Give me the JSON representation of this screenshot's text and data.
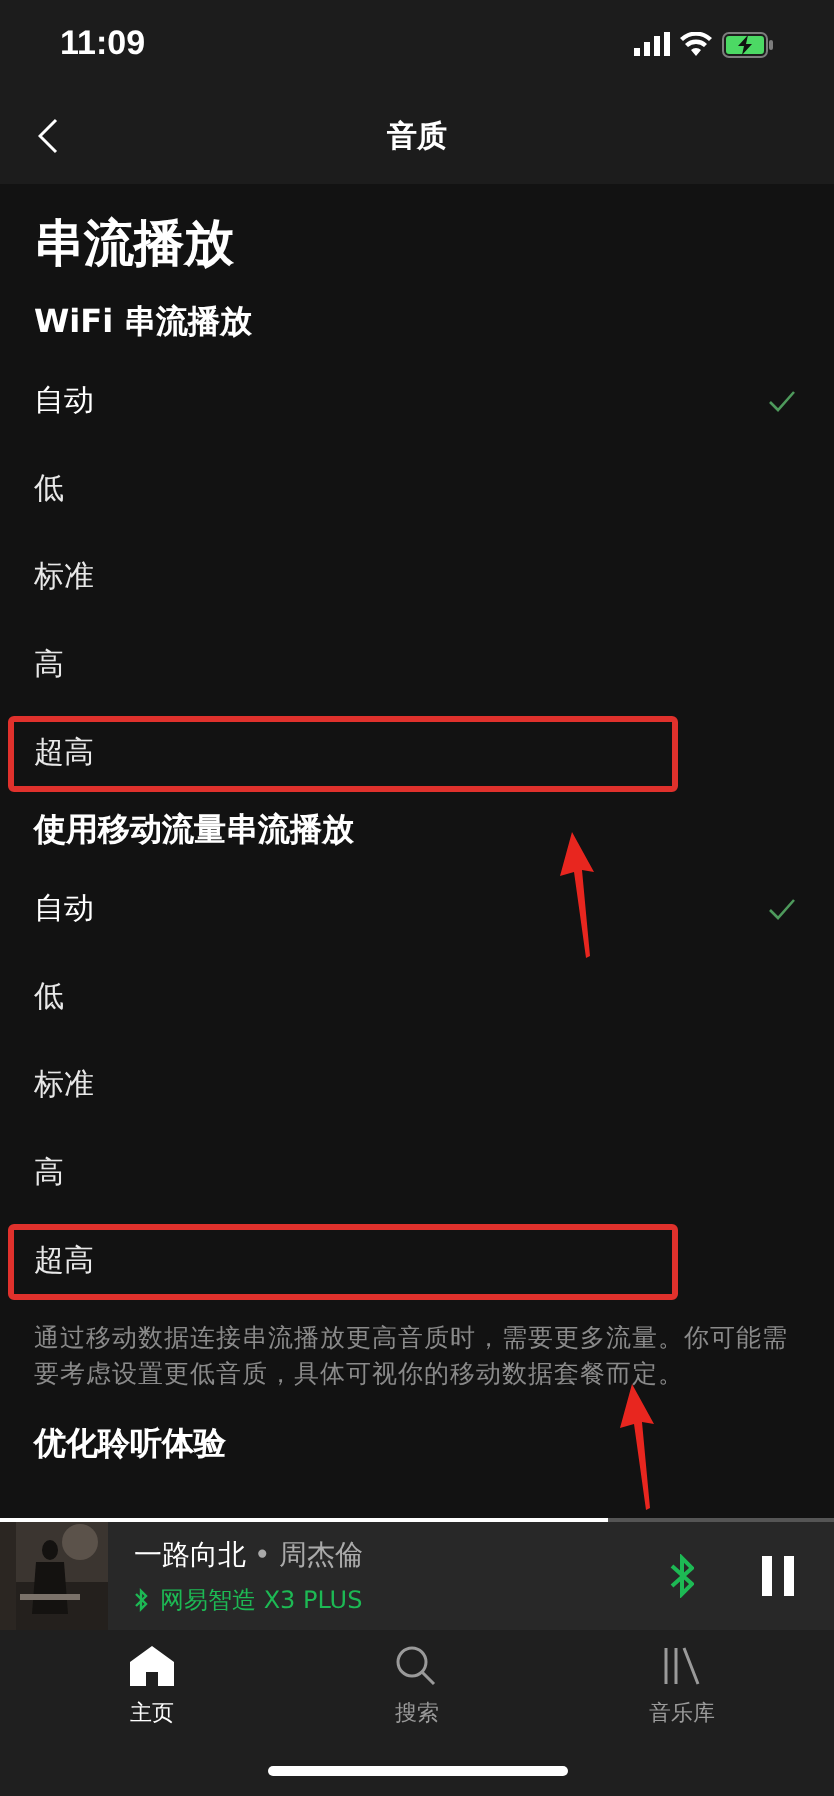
{
  "status_bar": {
    "time": "11:09"
  },
  "nav": {
    "title": "音质"
  },
  "page_title": "串流播放",
  "sections": [
    {
      "heading": "WiFi 串流播放",
      "options": [
        {
          "label": "自动",
          "selected": true,
          "highlighted": false
        },
        {
          "label": "低",
          "selected": false,
          "highlighted": false
        },
        {
          "label": "标准",
          "selected": false,
          "highlighted": false
        },
        {
          "label": "高",
          "selected": false,
          "highlighted": false
        },
        {
          "label": "超高",
          "selected": false,
          "highlighted": true
        }
      ]
    },
    {
      "heading": "使用移动流量串流播放",
      "options": [
        {
          "label": "自动",
          "selected": true,
          "highlighted": false
        },
        {
          "label": "低",
          "selected": false,
          "highlighted": false
        },
        {
          "label": "标准",
          "selected": false,
          "highlighted": false
        },
        {
          "label": "高",
          "selected": false,
          "highlighted": false
        },
        {
          "label": "超高",
          "selected": false,
          "highlighted": true
        }
      ],
      "note": "通过移动数据连接串流播放更高音质时，需要更多流量。你可能需要考虑设置更低音质，具体可视你的移动数据套餐而定。"
    }
  ],
  "next_heading": "优化聆听体验",
  "now_playing": {
    "level": 0.73,
    "title": "一路向北",
    "separator": "•",
    "artist": "周杰倫",
    "device": "网易智造 X3 PLUS",
    "playing": true
  },
  "tab_bar": [
    {
      "label": "主页",
      "selected": true
    },
    {
      "label": "搜索",
      "selected": false
    },
    {
      "label": "音乐库",
      "selected": false
    }
  ]
}
